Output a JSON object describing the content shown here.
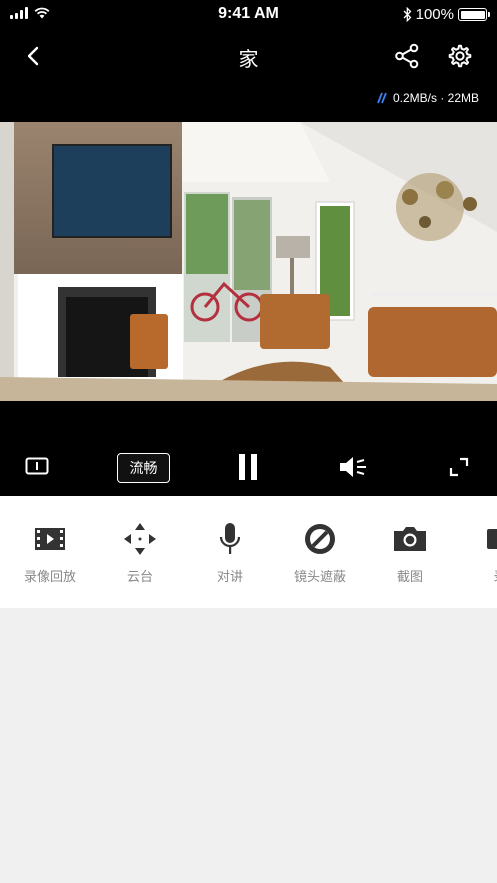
{
  "status_bar": {
    "time": "9:41 AM",
    "battery": "100%"
  },
  "nav": {
    "title": "家"
  },
  "stream": {
    "speed": "0.2MB/s · 22MB"
  },
  "controls": {
    "quality": "流畅"
  },
  "toolbar": {
    "items": [
      {
        "label": "录像回放",
        "icon": "film-icon"
      },
      {
        "label": "云台",
        "icon": "ptz-arrows-icon"
      },
      {
        "label": "对讲",
        "icon": "microphone-icon"
      },
      {
        "label": "镜头遮蔽",
        "icon": "lens-block-icon"
      },
      {
        "label": "截图",
        "icon": "camera-icon"
      },
      {
        "label": "录",
        "icon": "record-icon"
      }
    ]
  }
}
